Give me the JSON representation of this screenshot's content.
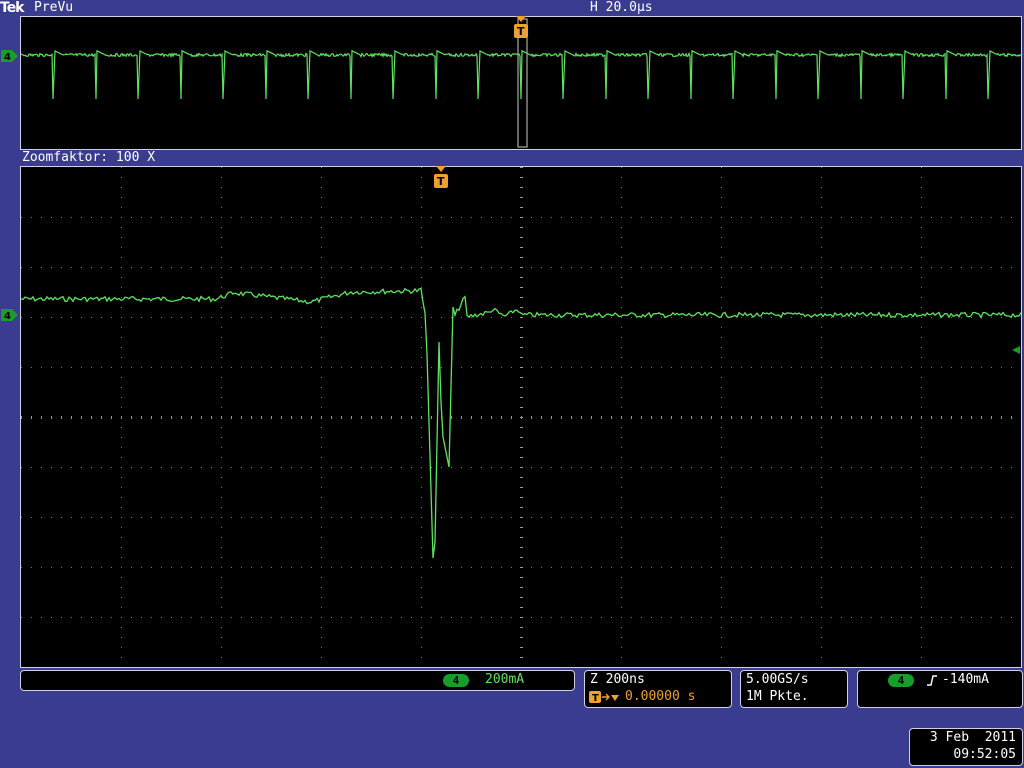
{
  "header": {
    "brand": "Tek",
    "mode": "PreVu",
    "horizontal_scale": "H 20.0µs"
  },
  "zoom": {
    "label": "Zoomfaktor: 100 X"
  },
  "channel": {
    "number": "4",
    "scale": "200mA",
    "color": "#5ee35e"
  },
  "timebase": {
    "zoom_scale": "Z 200ns",
    "trigger_offset": "0.00000 s"
  },
  "acquisition": {
    "sample_rate": "5.00GS/s",
    "record_length": "1M Pkte."
  },
  "trigger": {
    "channel": "4",
    "level": "-140mA",
    "marker_color": "#f0a030",
    "marker_label": "T"
  },
  "datetime": {
    "date": "3 Feb  2011",
    "time": "09:52:05"
  },
  "colors": {
    "background": "#3a3d8f",
    "trace": "#5ee35e",
    "grid": "#888888"
  }
}
